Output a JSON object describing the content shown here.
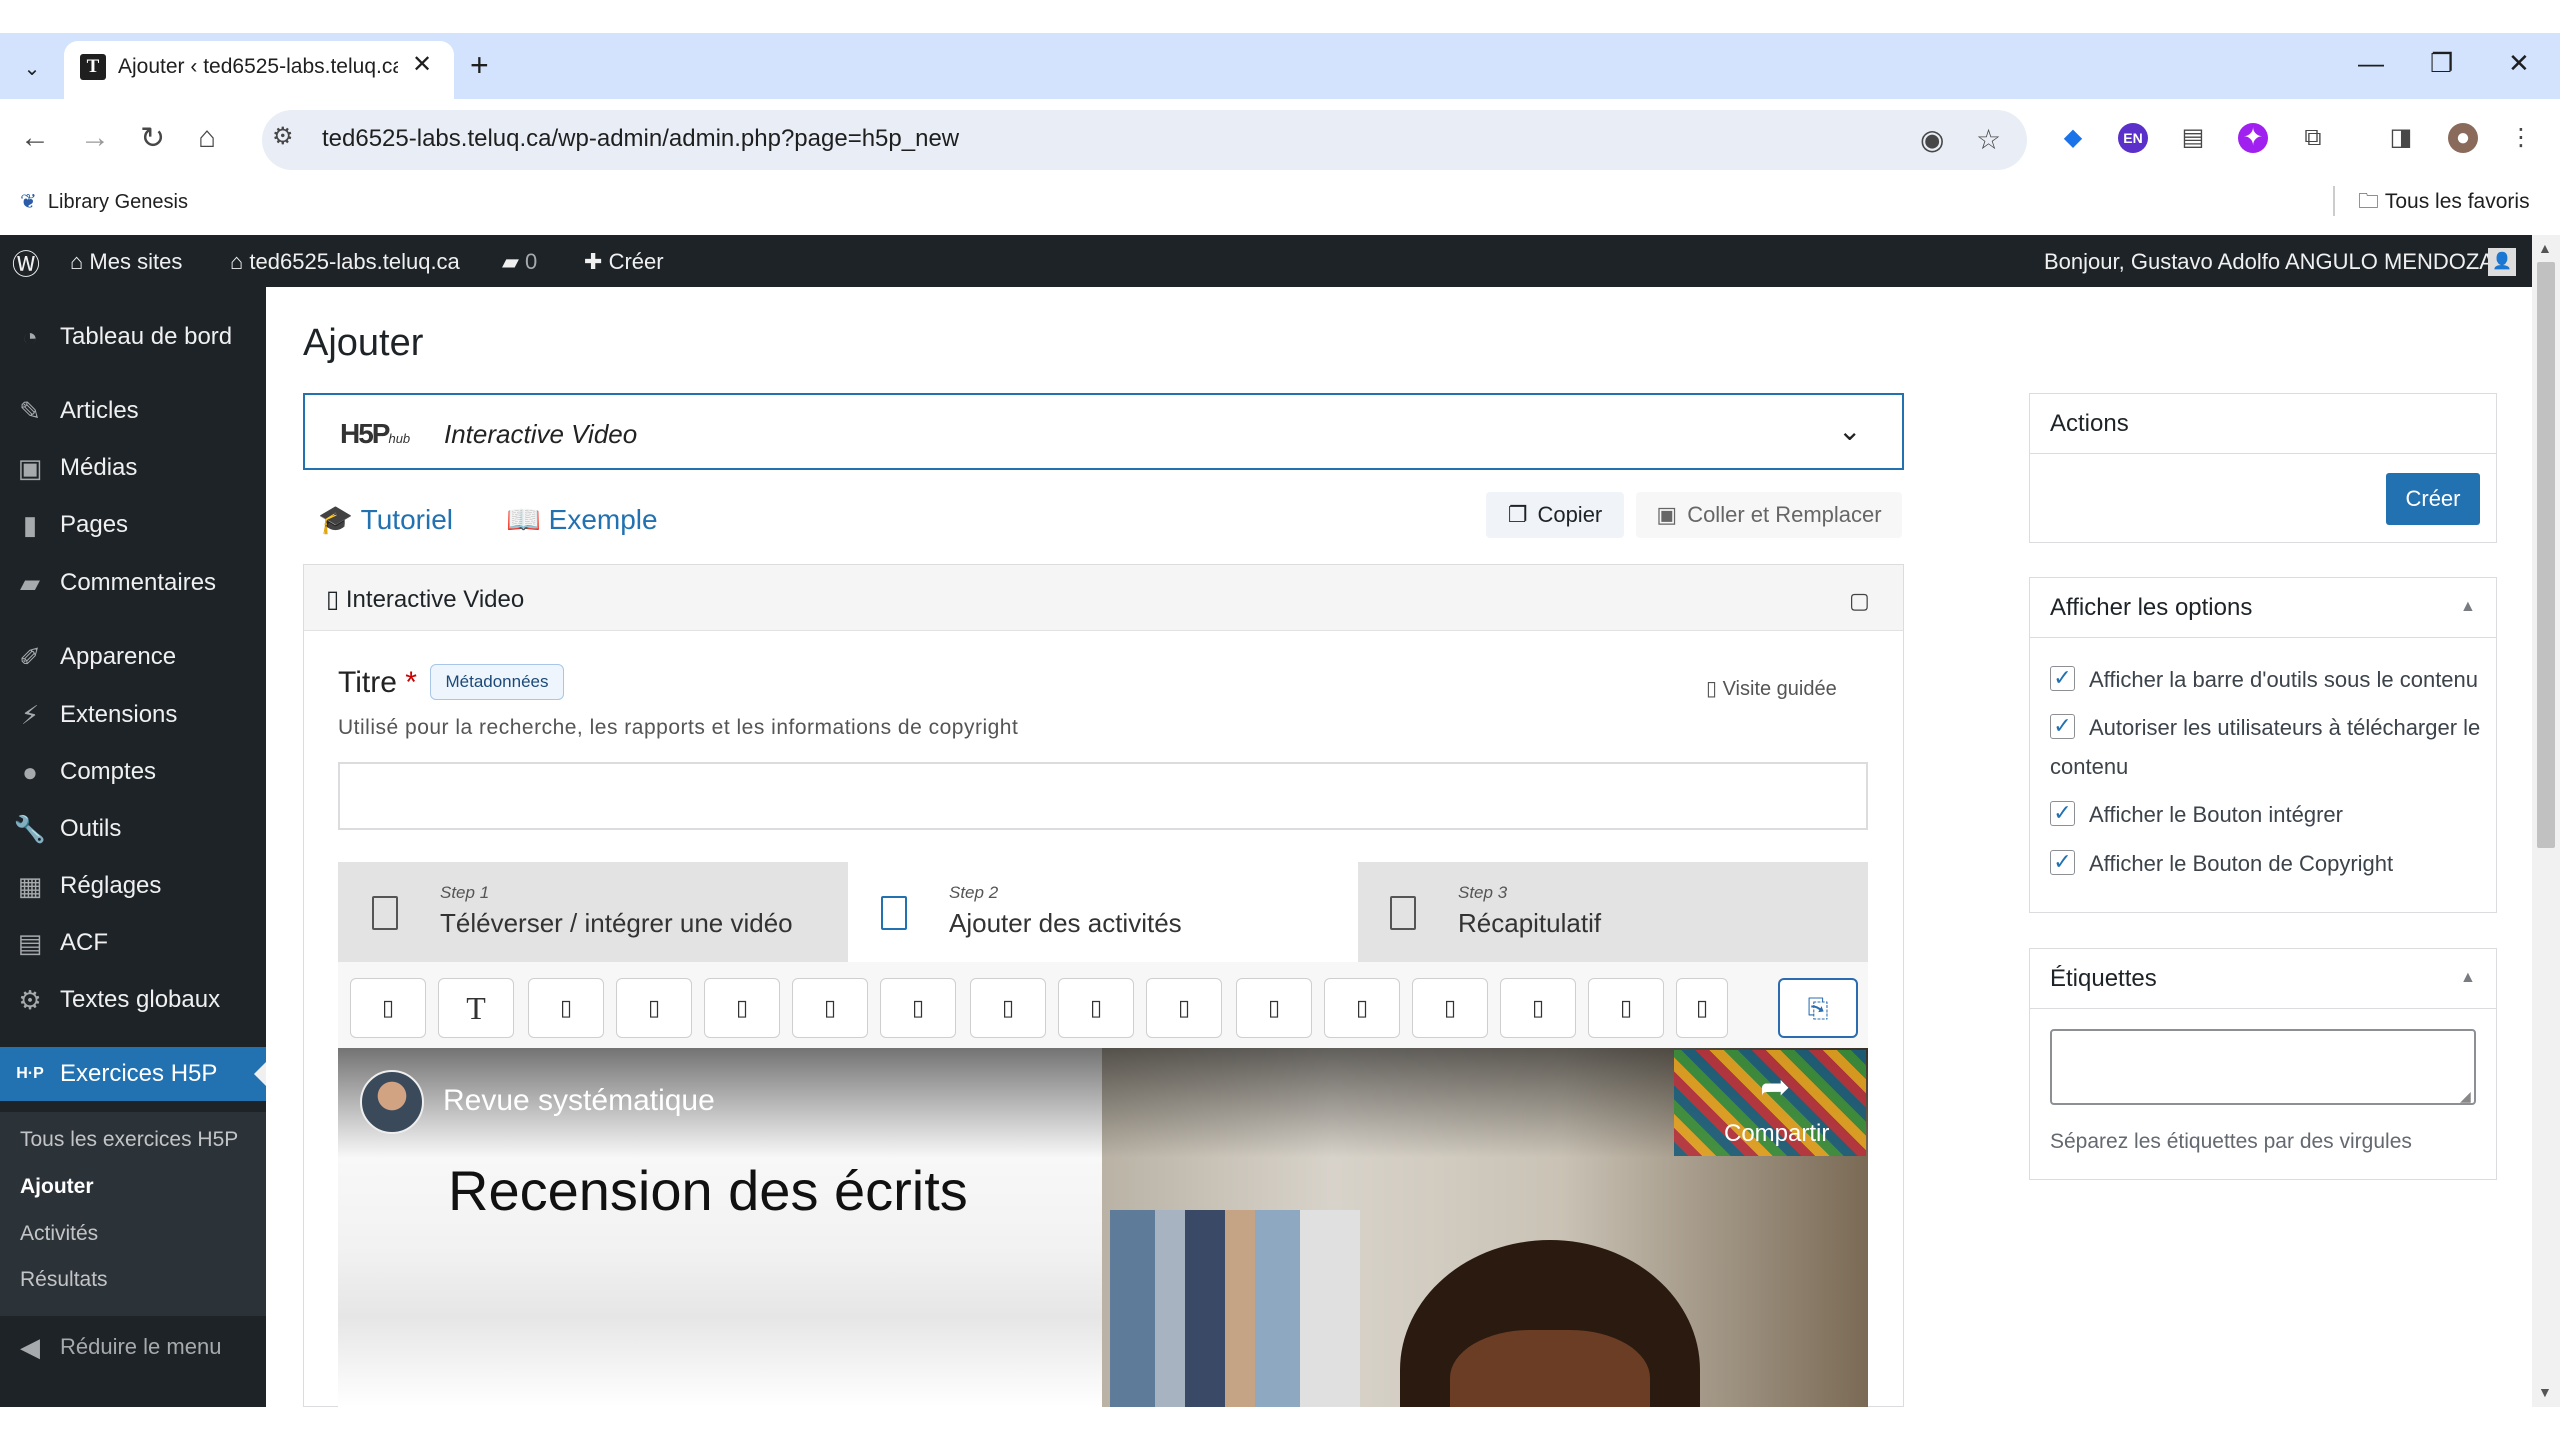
{
  "browser": {
    "tab_title": "Ajouter ‹ ted6525-labs.teluq.ca",
    "tab_favicon": "T",
    "url": "ted6525-labs.teluq.ca/wp-admin/admin.php?page=h5p_new",
    "bookmark_libgen": "Library Genesis",
    "bookmark_all": "Tous les favoris",
    "ext_en": "EN"
  },
  "adminbar": {
    "mes_sites": "Mes sites",
    "site": "ted6525-labs.teluq.ca",
    "comments_count": "0",
    "creer": "Créer",
    "greeting": "Bonjour, Gustavo Adolfo ANGULO MENDOZA"
  },
  "sidebar": {
    "items": [
      {
        "label": "Tableau de bord",
        "icon": "dashboard-icon"
      },
      {
        "label": "Articles",
        "icon": "pin-icon"
      },
      {
        "label": "Médias",
        "icon": "media-icon"
      },
      {
        "label": "Pages",
        "icon": "page-icon"
      },
      {
        "label": "Commentaires",
        "icon": "comment-icon"
      },
      {
        "label": "Apparence",
        "icon": "brush-icon"
      },
      {
        "label": "Extensions",
        "icon": "plugin-icon"
      },
      {
        "label": "Comptes",
        "icon": "user-icon"
      },
      {
        "label": "Outils",
        "icon": "wrench-icon"
      },
      {
        "label": "Réglages",
        "icon": "settings-icon"
      },
      {
        "label": "ACF",
        "icon": "grid-icon"
      },
      {
        "label": "Textes globaux",
        "icon": "gear-icon"
      },
      {
        "label": "Exercices H5P",
        "icon": "h5p-icon"
      }
    ],
    "h5p_icon_text": "H·P",
    "submenu": [
      "Tous les exercices H5P",
      "Ajouter",
      "Activités",
      "Résultats"
    ],
    "collapse": "Réduire le menu"
  },
  "main": {
    "title": "Ajouter",
    "hub_logo": "H5P",
    "hub_logo_sub": "hub",
    "hub_content_type": "Interactive Video",
    "tutoriel": "Tutoriel",
    "exemple": "Exemple",
    "copier": "Copier",
    "coller": "Coller et Remplacer",
    "editor_header": "Interactive Video",
    "titre_label": "Titre",
    "titre_required": "*",
    "metadonnees": "Métadonnées",
    "visite": "Visite guidée",
    "titre_desc": "Utilisé pour la recherche, les rapports et les informations de copyright",
    "titre_value": "",
    "steps": [
      {
        "num": "Step 1",
        "label": "Téléverser / intégrer une vidéo"
      },
      {
        "num": "Step 2",
        "label": "Ajouter des activités"
      },
      {
        "num": "Step 3",
        "label": "Récapitulatif"
      }
    ],
    "iv_toolbar_text_tool": "T",
    "video": {
      "channel_title": "Revue systématique",
      "slide_title": "Recension des écrits",
      "share": "Compartir"
    }
  },
  "panels": {
    "actions": {
      "title": "Actions",
      "button": "Créer"
    },
    "options": {
      "title": "Afficher les options",
      "items": [
        {
          "label": "Afficher la barre d'outils sous le contenu",
          "checked": true
        },
        {
          "label": "Autoriser les utilisateurs à télécharger le",
          "label_cont": "contenu",
          "checked": true
        },
        {
          "label": "Afficher le Bouton intégrer",
          "checked": true
        },
        {
          "label": "Afficher le Bouton de Copyright",
          "checked": true
        }
      ]
    },
    "tags": {
      "title": "Étiquettes",
      "hint": "Séparez les étiquettes par des virgules"
    }
  },
  "colors": {
    "wp_dark": "#1d2327",
    "wp_blue": "#2271b1",
    "chrome_tabbar": "#d3e3fd",
    "omnibox": "#e9eef6"
  }
}
